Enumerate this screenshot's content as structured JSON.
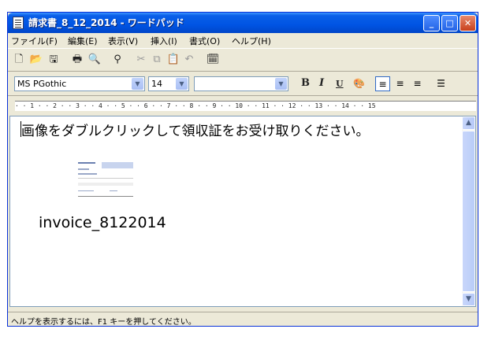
{
  "window": {
    "title": "請求書_8_12_2014 - ワードパッド"
  },
  "title_buttons": {
    "minimize": "_",
    "maximize": "□",
    "close": "✕"
  },
  "menu": [
    "ファイル(F)",
    "編集(E)",
    "表示(V)",
    "挿入(I)",
    "書式(O)",
    "ヘルプ(H)"
  ],
  "toolbar_icons": [
    "new-icon",
    "open-icon",
    "save-icon",
    "print-icon",
    "print-preview-icon",
    "find-icon",
    "cut-icon",
    "copy-icon",
    "paste-icon",
    "undo-icon",
    "date-time-icon"
  ],
  "format_bar": {
    "font": "MS PGothic",
    "size": "14",
    "script": "",
    "bold": "B",
    "italic": "I",
    "underline": "U"
  },
  "ruler": {
    "text": "· · 1 · · 2 · · 3 · · 4 · · 5 · · 6 · · 7 · · 8 · · 9 · · 10 · · 11 · · 12 · · 13 · · 14 · · 15"
  },
  "document": {
    "line1": "画像をダブルクリックして領収証をお受け取りください。",
    "object_label": "invoice_8122014"
  },
  "status": {
    "text": "ヘルプを表示するには、F1 キーを押してください。"
  }
}
